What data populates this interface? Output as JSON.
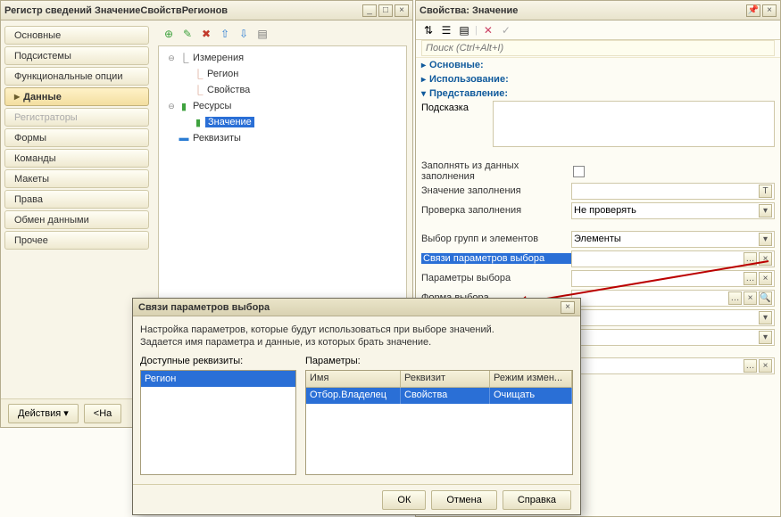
{
  "left": {
    "title": "Регистр сведений ЗначениеСвойствРегионов",
    "min": "_",
    "max": "□",
    "close": "×",
    "nav": [
      {
        "label": "Основные",
        "active": false
      },
      {
        "label": "Подсистемы",
        "active": false
      },
      {
        "label": "Функциональные опции",
        "active": false
      },
      {
        "label": "Данные",
        "active": true
      },
      {
        "label": "Регистраторы",
        "disabled": true
      },
      {
        "label": "Формы",
        "active": false
      },
      {
        "label": "Команды",
        "active": false
      },
      {
        "label": "Макеты",
        "active": false
      },
      {
        "label": "Права",
        "active": false
      },
      {
        "label": "Обмен данными",
        "active": false
      },
      {
        "label": "Прочее",
        "active": false
      }
    ],
    "toolbar": {
      "add_glyph": "⊕",
      "edit_glyph": "✎",
      "delete_glyph": "✖",
      "up_glyph": "⇧",
      "down_glyph": "⇩",
      "sort_glyph": "▤",
      "add_color": "#3fa23f",
      "edit_color": "#3fa23f",
      "delete_color": "#c23a2c",
      "arrow_color": "#2b7cd3"
    },
    "tree": {
      "dimensions": "Измерения",
      "region": "Регион",
      "property": "Свойства",
      "resources": "Ресурсы",
      "value": "Значение",
      "attributes": "Реквизиты"
    },
    "footer": {
      "actions": "Действия ▾",
      "back": "<На"
    }
  },
  "right": {
    "title": "Свойства: Значение",
    "close": "×",
    "pin": "📌",
    "search_placeholder": "Поиск (Ctrl+Alt+I)",
    "sections": {
      "main": "Основные:",
      "usage": "Использование:",
      "present": "Представление:"
    },
    "tooltip_label": "Подсказка",
    "tooltip_value": "",
    "rows": {
      "fill_from": {
        "label": "Заполнять из данных заполнения",
        "checked": false
      },
      "fill_value": {
        "label": "Значение заполнения",
        "value": "",
        "iconT": "T"
      },
      "fill_check": {
        "label": "Проверка заполнения",
        "value": "Не проверять",
        "dropdown": true
      },
      "group_sel": {
        "label": "Выбор групп и элементов",
        "value": "Элементы",
        "dropdown": true
      },
      "link_params": {
        "label": "Связи параметров выбора",
        "value": "",
        "dots": true,
        "clear": true,
        "highlighted": true
      },
      "sel_params": {
        "label": "Параметры выбора",
        "value": "",
        "dots": true,
        "clear": true
      },
      "form_sel": {
        "label": "Форма выбора",
        "value": "",
        "dots": true,
        "clear": true,
        "search": true
      }
    },
    "extras": [
      {
        "value": "",
        "dropdown": true
      },
      {
        "value": "",
        "dropdown": true
      },
      {
        "value": "",
        "dots": true,
        "clear": true
      }
    ]
  },
  "dialog": {
    "title": "Связи параметров выбора",
    "close": "×",
    "desc1": "Настройка параметров, которые будут использоваться при выборе значений.",
    "desc2": "Задается имя параметра и данные, из которых брать значение.",
    "col1_label": "Доступные реквизиты:",
    "col2_label": "Параметры:",
    "available": [
      {
        "label": "Регион",
        "selected": true
      }
    ],
    "headers": {
      "name": "Имя",
      "req": "Реквизит",
      "mode": "Режим измен..."
    },
    "rows": [
      {
        "name": "Отбор.Владелец",
        "req": "Свойства",
        "mode": "Очищать",
        "selected": true
      }
    ],
    "buttons": {
      "ok": "ОК",
      "cancel": "Отмена",
      "help": "Справка"
    }
  }
}
